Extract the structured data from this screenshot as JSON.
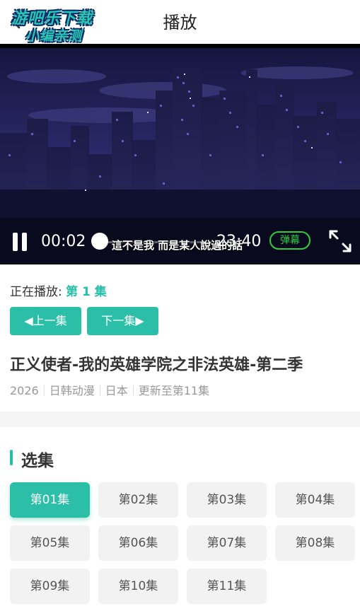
{
  "header": {
    "title": "播放",
    "watermark_line1": "游吧乐下载",
    "watermark_line2": "小编亲测"
  },
  "player": {
    "current_time": "00:02",
    "total_time": "23:40",
    "subtitle": "這不是我 而是某人說過的話",
    "danmu_label": "弹幕",
    "progress": 0.0014
  },
  "now_playing": {
    "label": "正在播放:",
    "episode": "第 1 集"
  },
  "nav": {
    "prev_label": "◀上一集",
    "next_label": "下一集▶"
  },
  "show": {
    "title": "正义使者-我的英雄学院之非法英雄-第二季",
    "year": "2026",
    "category": "日韩动漫",
    "region": "日本",
    "status": "更新至第11集"
  },
  "episodes": {
    "section_title": "选集",
    "items": [
      "第01集",
      "第02集",
      "第03集",
      "第04集",
      "第05集",
      "第06集",
      "第07集",
      "第08集",
      "第09集",
      "第10集",
      "第11集"
    ],
    "active_index": 0
  },
  "colors": {
    "accent": "#2bbfa8",
    "danmu": "#2ecc40"
  }
}
